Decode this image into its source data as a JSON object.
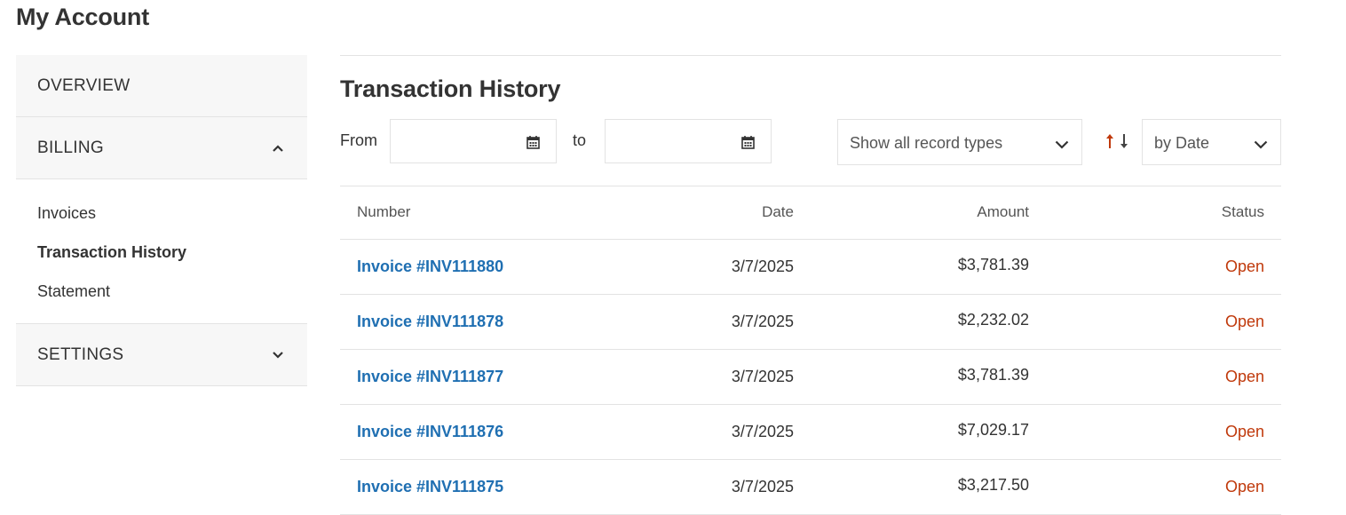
{
  "page": {
    "title": "My Account"
  },
  "sidebar": {
    "overview": "OVERVIEW",
    "billing": "BILLING",
    "billing_items": [
      "Invoices",
      "Transaction History",
      "Statement"
    ],
    "settings": "SETTINGS"
  },
  "main": {
    "title": "Transaction History",
    "filters": {
      "from_label": "From",
      "to_label": "to",
      "from_value": "",
      "to_value": "",
      "record_type": "Show all record types",
      "sort_by": "by Date"
    },
    "table": {
      "headers": {
        "number": "Number",
        "date": "Date",
        "amount": "Amount",
        "status": "Status"
      },
      "rows": [
        {
          "number": "Invoice #INV111880",
          "date": "3/7/2025",
          "amount": "$3,781.39",
          "status": "Open"
        },
        {
          "number": "Invoice #INV111878",
          "date": "3/7/2025",
          "amount": "$2,232.02",
          "status": "Open"
        },
        {
          "number": "Invoice #INV111877",
          "date": "3/7/2025",
          "amount": "$3,781.39",
          "status": "Open"
        },
        {
          "number": "Invoice #INV111876",
          "date": "3/7/2025",
          "amount": "$7,029.17",
          "status": "Open"
        },
        {
          "number": "Invoice #INV111875",
          "date": "3/7/2025",
          "amount": "$3,217.50",
          "status": "Open"
        }
      ]
    }
  },
  "colors": {
    "link": "#1f6fb2",
    "status_open": "#c0390b",
    "sort_active": "#c0390b"
  },
  "icons": [
    "calendar-icon",
    "chevron-up-icon",
    "chevron-down-icon",
    "sort-asc-icon",
    "sort-desc-icon"
  ]
}
